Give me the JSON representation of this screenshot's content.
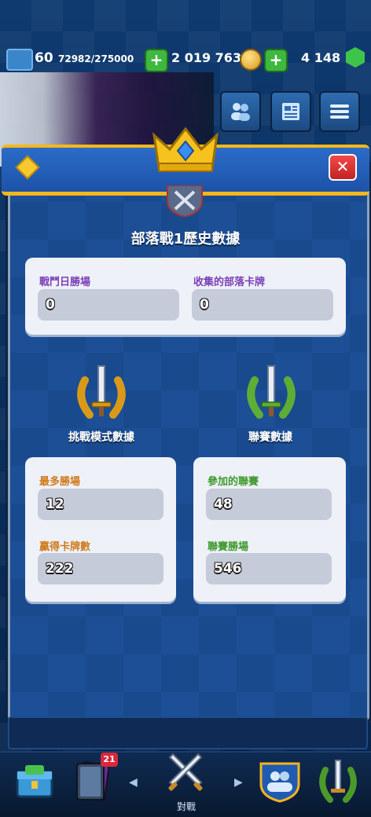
{
  "topbar": {
    "level": "60",
    "xp": "72982/275000",
    "gold": "2 019 763",
    "gems": "4 148"
  },
  "modal": {
    "title": "部落戰1歷史數據",
    "clan_war": {
      "battle_day_wins_label": "戰鬥日勝場",
      "battle_day_wins_value": "0",
      "cards_collected_label": "收集的部落卡牌",
      "cards_collected_value": "0"
    },
    "challenge": {
      "section_label": "挑戰模式數據",
      "max_wins_label": "最多勝場",
      "max_wins_value": "12",
      "cards_won_label": "贏得卡牌數",
      "cards_won_value": "222"
    },
    "tournament": {
      "section_label": "聯賽數據",
      "played_label": "參加的聯賽",
      "played_value": "48",
      "wins_label": "聯賽勝場",
      "wins_value": "546"
    }
  },
  "bottom_nav": {
    "cards_badge": "21",
    "battle_label": "對戰"
  },
  "colors": {
    "purple_label": "#7b3fb6",
    "orange_label": "#d07a1a",
    "green_label": "#3f9a2e",
    "header_gold": "#f3b81c"
  }
}
